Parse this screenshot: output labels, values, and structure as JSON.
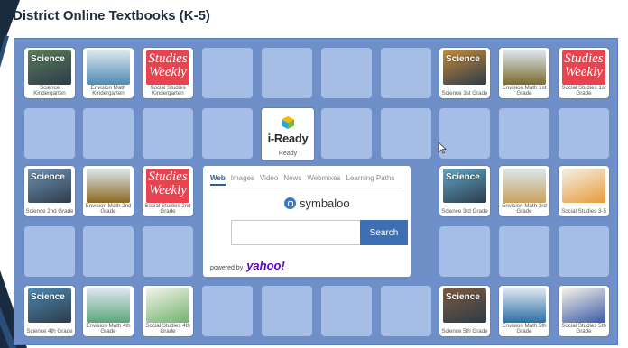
{
  "page": {
    "title": "District Online Textbooks (K-5)"
  },
  "tiles": [
    {
      "label": "Science Kindergarten",
      "cover": "science",
      "art": "#5a7c5a"
    },
    {
      "label": "Envision Math Kindergarten",
      "cover": "math",
      "art": "#4f8bb4"
    },
    {
      "label": "Social Studies Kindergarten",
      "cover": "studies"
    },
    {
      "label": "Science 1st Grade",
      "cover": "science",
      "art": "#c18a3a"
    },
    {
      "label": "Envision Math 1st Grade",
      "cover": "math",
      "art": "#7a6a2d"
    },
    {
      "label": "Social Studies 1st Grade",
      "cover": "studies"
    },
    {
      "label": "Science 2nd Grade",
      "cover": "science",
      "art": "#6f95b5"
    },
    {
      "label": "Envision Math 2nd Grade",
      "cover": "math",
      "art": "#8a6a20"
    },
    {
      "label": "Social Studies 2nd Grade",
      "cover": "studies"
    },
    {
      "label": "Science 3rd Grade",
      "cover": "science",
      "art": "#5fa7c9"
    },
    {
      "label": "Envision Math 3rd Grade",
      "cover": "math",
      "art": "#c9a15a"
    },
    {
      "label": "Social Studies 3-5",
      "cover": "social",
      "art": "#e69a3a"
    },
    {
      "label": "Science 4th Grade",
      "cover": "science",
      "art": "#4c88b0"
    },
    {
      "label": "Envision Math 4th Grade",
      "cover": "math",
      "art": "#5da57a"
    },
    {
      "label": "Social Studies 4th Grade",
      "cover": "social",
      "art": "#6fb36f"
    },
    {
      "label": "Science 5th Grade",
      "cover": "science",
      "art": "#7e5a3e"
    },
    {
      "label": "Envision Math 5th Grade",
      "cover": "math",
      "art": "#2a6fa5"
    },
    {
      "label": "Social Studies 5th Grade",
      "cover": "social",
      "art": "#3a5aa8"
    }
  ],
  "studies_text": {
    "line1": "Studies",
    "line2": "Weekly"
  },
  "science_text": "Science",
  "iready": {
    "logo": "i-Ready",
    "label": "Ready"
  },
  "search_widget": {
    "tabs": [
      "Web",
      "Images",
      "Video",
      "News",
      "Webmixes",
      "Learning Paths"
    ],
    "active_tab": "Web",
    "brand": "symbaloo",
    "query": "",
    "button": "Search",
    "powered_by": "powered by",
    "provider": "yahoo!"
  },
  "colors": {
    "board": "#6f8fc9",
    "empty_tile": "#a9c0e8",
    "search_button": "#3d6fb5",
    "yahoo": "#5f01d1",
    "studies_weekly": "#e8434f"
  }
}
